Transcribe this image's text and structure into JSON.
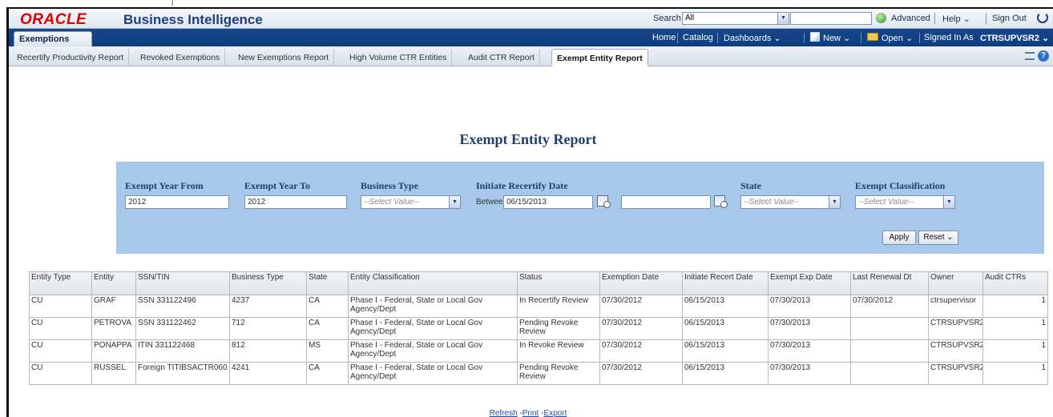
{
  "header": {
    "logo": "ORACLE",
    "app_title": "Business Intelligence",
    "search_label": "Search",
    "search_scope": "All",
    "advanced": "Advanced",
    "help": "Help ⌄",
    "sign_out": "Sign Out"
  },
  "nav": {
    "dashboard_tab": "Exemptions",
    "home": "Home",
    "catalog": "Catalog",
    "dashboards": "Dashboards ⌄",
    "new": "New ⌄",
    "open": "Open ⌄",
    "signed_in_as_label": "Signed In As",
    "signed_in_user": "CTRSUPVSR2 ⌄"
  },
  "tabs": [
    "Recertify Productivity Report",
    "Revoked Exemptions",
    "New Exemptions Report",
    "High Volume CTR Entities",
    "Audit CTR Report",
    "Exempt Entity Report"
  ],
  "report": {
    "title": "Exempt Entity Report"
  },
  "prompts": {
    "exempt_year_from_label": "Exempt Year From",
    "exempt_year_from_value": "2012",
    "exempt_year_to_label": "Exempt Year To",
    "exempt_year_to_value": "2012",
    "business_type_label": "Business Type",
    "business_type_value": "--Select Value--",
    "initiate_recertify_label": "Initiate Recertify Date",
    "between_label": "Between",
    "initiate_from_value": "06/15/2013",
    "state_label": "State",
    "state_value": "--Select Value--",
    "exempt_class_label": "Exempt Classification",
    "exempt_class_value": "--Select Value--",
    "apply": "Apply",
    "reset": "Reset ⌄"
  },
  "table": {
    "headers": [
      "Entity Type",
      "Entity",
      "SSN/TIN",
      "Business Type",
      "State",
      "Entity Classification",
      "Status",
      "Exemption Date",
      "Initiate Recert Date",
      "Exempt Exp Date",
      "Last Renewal Dt",
      "Owner",
      "Audit CTRs"
    ],
    "rows": [
      [
        "CU",
        "GRAF",
        "SSN 331122496",
        "4237",
        "CA",
        "Phase I - Federal, State or Local Gov Agency/Dept",
        "In Recertify Review",
        "07/30/2012",
        "06/15/2013",
        "07/30/2013",
        "07/30/2012",
        "ctrsupervisor",
        "1"
      ],
      [
        "CU",
        "PETROVA",
        "SSN 331122462",
        "712",
        "CA",
        "Phase I - Federal, State or Local Gov Agency/Dept",
        "Pending Revoke Review",
        "07/30/2012",
        "06/15/2013",
        "07/30/2013",
        "",
        "CTRSUPVSR2",
        "1"
      ],
      [
        "CU",
        "PONAPPA",
        "ITIN 331122468",
        "812",
        "MS",
        "Phase I - Federal, State or Local Gov Agency/Dept",
        "In Revoke Review",
        "07/30/2012",
        "06/15/2013",
        "07/30/2013",
        "",
        "CTRSUPVSR2",
        "1"
      ],
      [
        "CU",
        "RUSSEL",
        "Foreign TITIBSACTR060",
        "4241",
        "CA",
        "Phase I - Federal, State or Local Gov Agency/Dept",
        "Pending Revoke Review",
        "07/30/2012",
        "06/15/2013",
        "07/30/2013",
        "",
        "CTRSUPVSR2",
        "1"
      ]
    ]
  },
  "footer": {
    "refresh": "Refresh",
    "print": "Print",
    "export": "Export"
  },
  "colors": {
    "header_blue": "#0f3d80",
    "prompt_panel": "#a7c8ea",
    "title_navy": "#1d3f6e",
    "oracle_red": "#e00000"
  }
}
